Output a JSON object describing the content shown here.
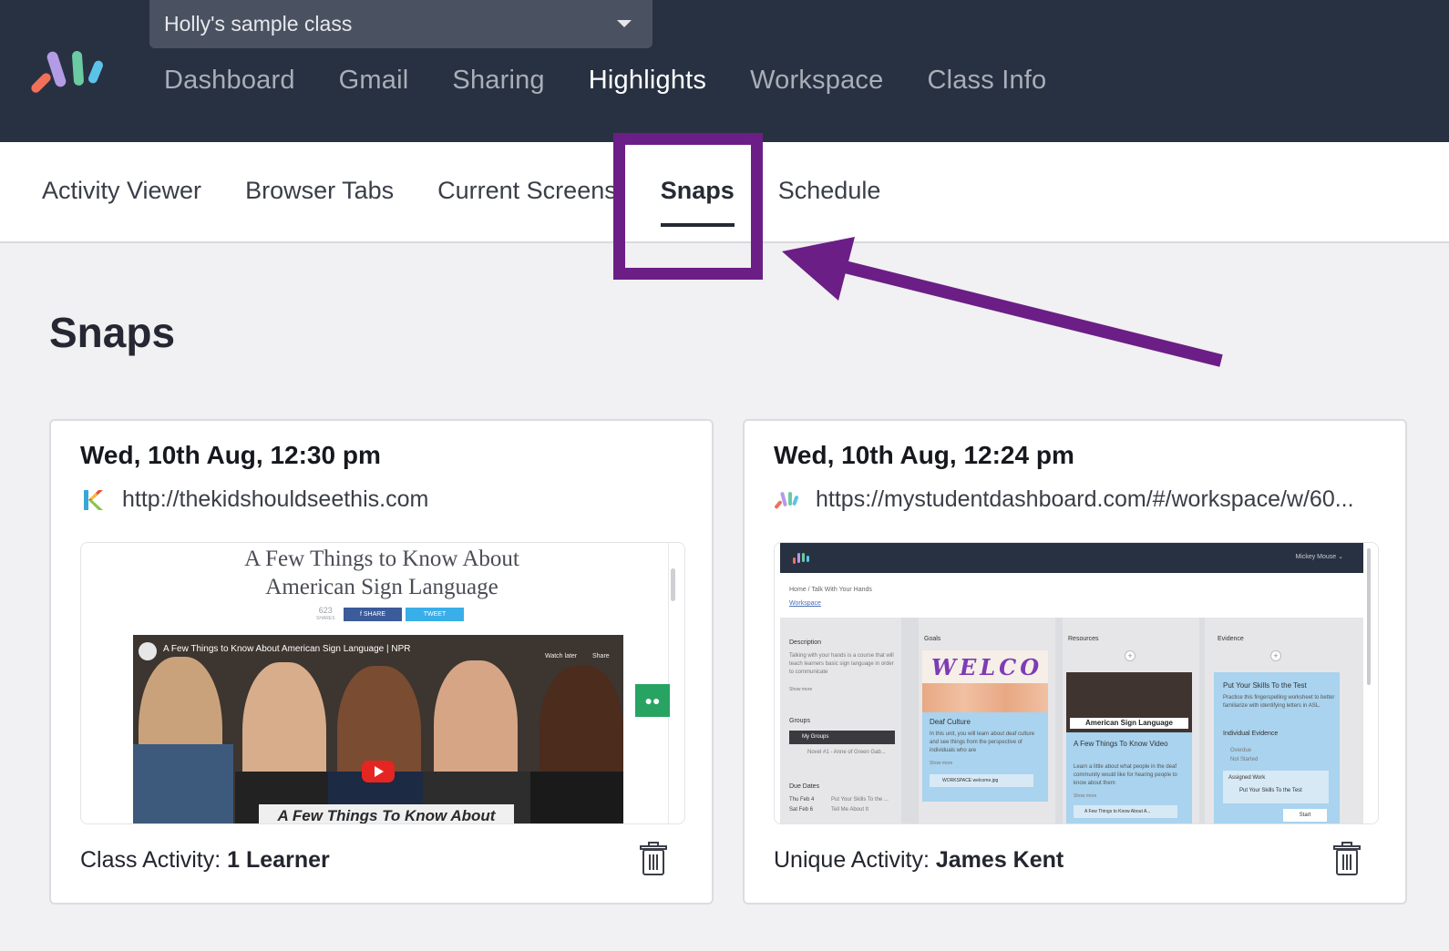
{
  "app": {
    "class_selector": "Holly's sample class",
    "main_nav": [
      "Dashboard",
      "Gmail",
      "Sharing",
      "Highlights",
      "Workspace",
      "Class Info"
    ],
    "active_main_nav": "Highlights"
  },
  "sub_nav": {
    "tabs": [
      "Activity Viewer",
      "Browser Tabs",
      "Current Screens",
      "Snaps",
      "Schedule"
    ],
    "active_tab": "Snaps"
  },
  "annotation": {
    "color": "#6b1e85"
  },
  "page": {
    "title": "Snaps"
  },
  "snaps": [
    {
      "date": "Wed, 10th Aug, 12:30 pm",
      "url": "http://thekidshouldseethis.com",
      "favicon": "kidshouldseethis-logo-icon",
      "thumbnail": {
        "title_line1": "A Few Things to Know About",
        "title_line2": "American Sign Language",
        "shares_count": "623",
        "shares_label": "SHARES",
        "share_button": "SHARE",
        "tweet_button": "TWEET",
        "video_title": "A Few Things to Know About American Sign Language | NPR",
        "watch_later": "Watch later",
        "share_label": "Share",
        "caption": "A Few Things To Know About"
      },
      "footer_label": "Class Activity:",
      "footer_value": "1 Learner"
    },
    {
      "date": "Wed, 10th Aug, 12:24 pm",
      "url": "https://mystudentdashboard.com/#/workspace/w/60...",
      "favicon": "mystudentdashboard-logo-icon",
      "thumbnail": {
        "user_menu": "Mickey Mouse ⌄",
        "breadcrumb": "Home  /  Talk With Your Hands",
        "breadcrumb_link": "Workspace",
        "description_label": "Description",
        "description_text": "Talking with your hands is a course that will teach learners basic sign language in order to communicate",
        "show_more": "Show more",
        "groups_label": "Groups",
        "group_1": "My Groups",
        "group_2": "Novel #1 - Anne of Green Gab...",
        "due_dates_label": "Due Dates",
        "due_1_date": "Thu Feb 4",
        "due_1_text": "Put Your Skills To the ...",
        "due_2_date": "Sat Feb 6",
        "due_2_text": "Tell Me About It",
        "goals_label": "Goals",
        "goal_image_text": "WELCO",
        "goal_card_title": "Deaf Culture",
        "goal_card_text": "In this unit, you will learn about deaf culture and see things from the perspective of individuals who are",
        "goal_file": "WORKSPACE welcome.jpg",
        "resources_label": "Resources",
        "resource_banner": "American Sign Language",
        "resource_card_title": "A Few Things To Know Video",
        "resource_card_text": "Learn a little about what people in the deaf community would like for hearing people to know about them",
        "resource_link": "A Few Things to Know About A...",
        "evidence_label": "Evidence",
        "evidence_card_title": "Put Your Skills To the Test",
        "evidence_card_text": "Practice this fingerspelling worksheet to better familiarize with identifying letters in ASL.",
        "individual_evidence": "Individual Evidence",
        "overdue": "Overdue",
        "not_started": "Not Started",
        "assigned_work": "Assigned Work",
        "assigned_item": "Put Your Skills To the Test",
        "start_button": "Start"
      },
      "footer_label": "Unique Activity:",
      "footer_value": "James Kent"
    }
  ]
}
